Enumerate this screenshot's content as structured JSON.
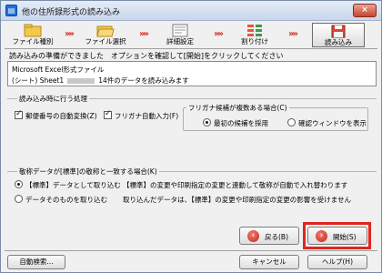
{
  "window": {
    "title": "他の住所録形式の読み込み",
    "close_label": "×"
  },
  "steps": [
    {
      "label": "ファイル種別"
    },
    {
      "label": "ファイル選択"
    },
    {
      "label": "詳細設定"
    },
    {
      "label": "割り付け"
    },
    {
      "label": "読み込み"
    }
  ],
  "arrow_glyph": "»»",
  "instruction": "読み込みの準備ができました　オプションを確認して[開始]をクリックしてください",
  "info": {
    "line1": "Microsoft Excel形式ファイル",
    "line2_prefix": "(シート) Sheet1",
    "line2_suffix": "14件のデータを読み込みます"
  },
  "options": {
    "group_label": "読み込み時に行う処理",
    "postal_auto_convert": {
      "label": "郵便番号の自動変換(Z)",
      "checked": true
    },
    "furigana_auto": {
      "label": "フリガナ自動入力(F)",
      "checked": true
    },
    "furigana_group_label": "フリガナ候補が複数ある場合(C)",
    "furigana_choices": [
      {
        "label": "最初の候補を採用",
        "selected": true
      },
      {
        "label": "確認ウィンドウを表示",
        "selected": false
      }
    ]
  },
  "match": {
    "group_label": "敬称データが[標準]の敬称と一致する場合(K)",
    "choices": [
      {
        "label": "【標準】データとして取り込む",
        "desc": "【標準】の変更や印刷指定の変更と連動して敬称が自動で入れ替わります",
        "selected": true
      },
      {
        "label": "データそのものを取り込む",
        "desc": "取り込んだデータは、【標準】の変更や印刷指定の変更の影響を受けません",
        "selected": false
      }
    ]
  },
  "buttons": {
    "back": "戻る(B)",
    "start": "開始(S)",
    "auto_search": "自動検索...",
    "cancel": "キャンセル",
    "help": "ヘルプ(H)"
  },
  "colors": {
    "accent_red": "#e1251b",
    "arrow_red": "#d9221b"
  }
}
